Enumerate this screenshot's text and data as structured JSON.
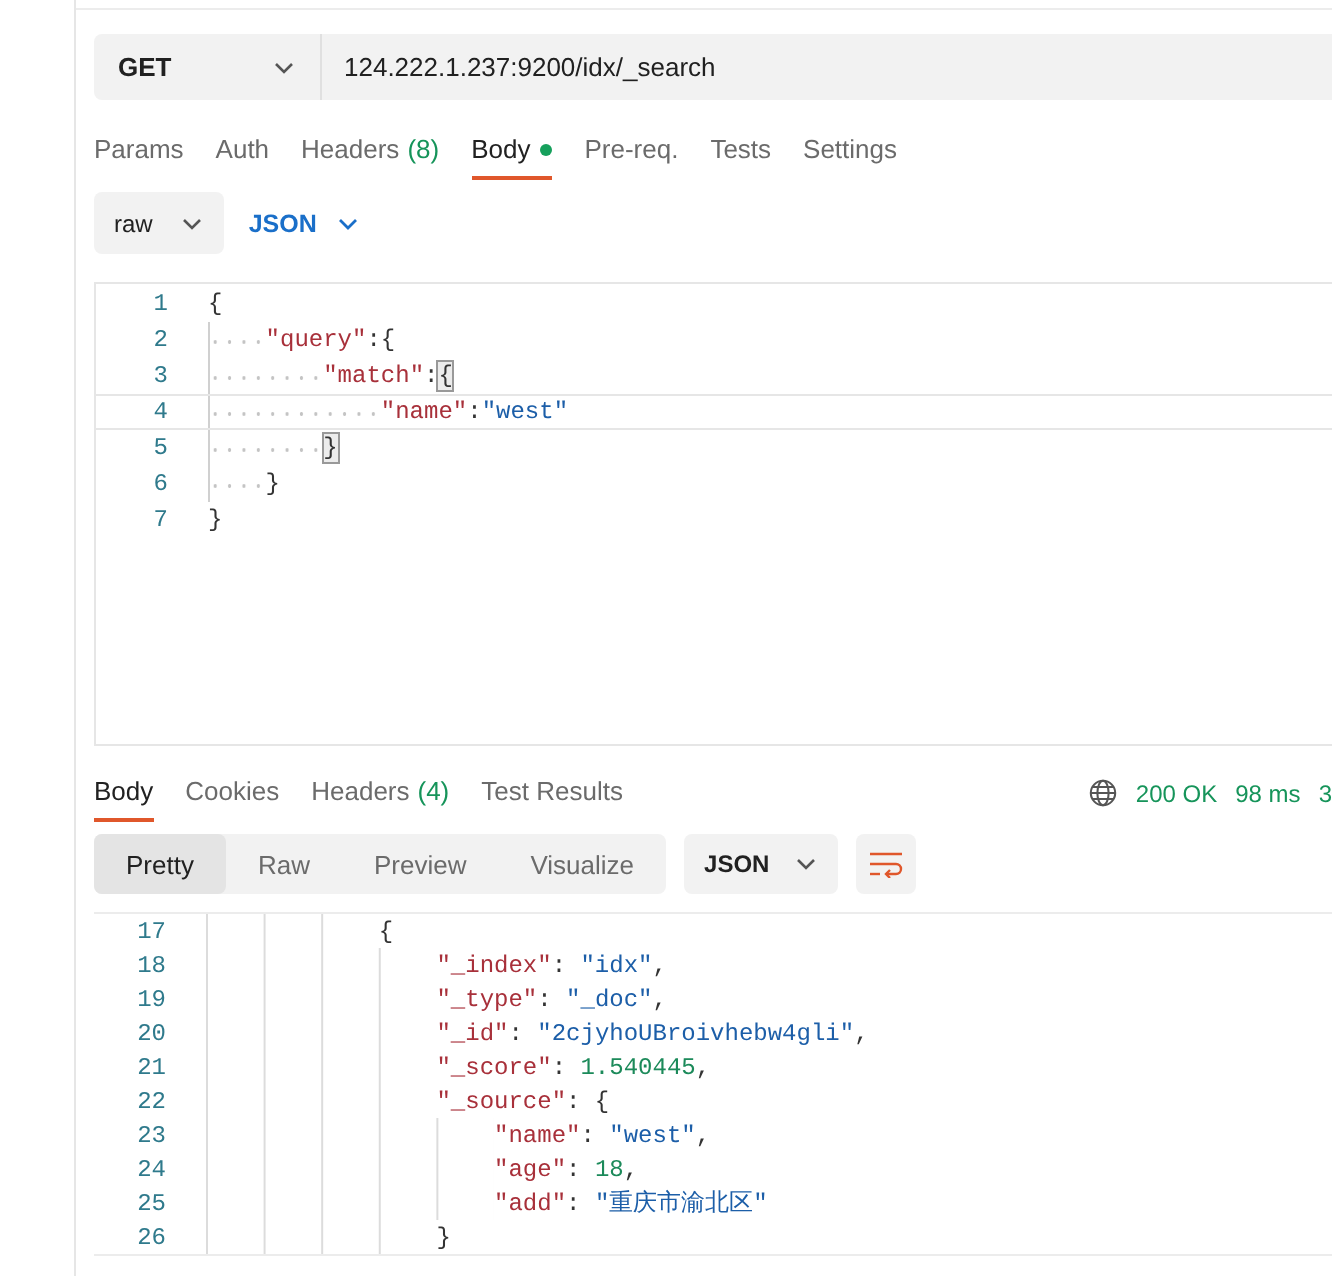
{
  "request": {
    "method": "GET",
    "url": "124.222.1.237:9200/idx/_search"
  },
  "request_tabs": [
    {
      "label": "Params",
      "selected": false
    },
    {
      "label": "Auth",
      "selected": false
    },
    {
      "label": "Headers",
      "count": "(8)",
      "selected": false
    },
    {
      "label": "Body",
      "dot": true,
      "selected": true
    },
    {
      "label": "Pre-req.",
      "selected": false
    },
    {
      "label": "Tests",
      "selected": false
    },
    {
      "label": "Settings",
      "selected": false
    }
  ],
  "body_mode": "raw",
  "body_language": "JSON",
  "request_body": [
    {
      "number": "1",
      "active": false,
      "tokens": [
        {
          "kind": "punct",
          "text": "{"
        }
      ],
      "children": [
        {
          "number": "2",
          "active": false,
          "tokens": [
            {
              "kind": "key",
              "text": "\"query\""
            },
            {
              "kind": "punct",
              "text": ":{"
            }
          ],
          "children": [
            {
              "number": "3",
              "active": false,
              "tokens": [
                {
                  "kind": "key",
                  "text": "\"match\""
                },
                {
                  "kind": "punct",
                  "text": ":"
                },
                {
                  "kind": "punct",
                  "text": "{",
                  "matched": true
                }
              ],
              "children": [
                {
                  "number": "4",
                  "active": true,
                  "tokens": [
                    {
                      "kind": "key",
                      "text": "\"name\""
                    },
                    {
                      "kind": "punct",
                      "text": ":"
                    },
                    {
                      "kind": "string",
                      "text": "\"west\""
                    }
                  ]
                }
              ]
            },
            {
              "number": "5",
              "active": false,
              "tokens": [
                {
                  "kind": "punct",
                  "text": "}",
                  "matched": true
                }
              ]
            }
          ]
        },
        {
          "number": "6",
          "active": false,
          "tokens": [
            {
              "kind": "punct",
              "text": "}"
            }
          ]
        }
      ]
    },
    {
      "number": "7",
      "active": false,
      "tokens": [
        {
          "kind": "punct",
          "text": "}"
        }
      ]
    }
  ],
  "response_tabs": [
    {
      "label": "Body",
      "selected": true
    },
    {
      "label": "Cookies",
      "selected": false
    },
    {
      "label": "Headers",
      "count": "(4)",
      "selected": false
    },
    {
      "label": "Test Results",
      "selected": false
    }
  ],
  "response_status": {
    "status": "200 OK",
    "time": "98 ms",
    "size": "3"
  },
  "view_modes": [
    {
      "label": "Pretty",
      "selected": true
    },
    {
      "label": "Raw",
      "selected": false
    },
    {
      "label": "Preview",
      "selected": false
    },
    {
      "label": "Visualize",
      "selected": false
    }
  ],
  "response_format": "JSON",
  "response_body": [
    {
      "number": "17",
      "tokens": [
        {
          "kind": "punct",
          "text": "{"
        }
      ],
      "children": [
        {
          "number": "18",
          "tokens": [
            {
              "kind": "key",
              "text": "\"_index\""
            },
            {
              "kind": "punct",
              "text": ": "
            },
            {
              "kind": "string",
              "text": "\"idx\""
            },
            {
              "kind": "punct",
              "text": ","
            }
          ]
        },
        {
          "number": "19",
          "tokens": [
            {
              "kind": "key",
              "text": "\"_type\""
            },
            {
              "kind": "punct",
              "text": ": "
            },
            {
              "kind": "string",
              "text": "\"_doc\""
            },
            {
              "kind": "punct",
              "text": ","
            }
          ]
        },
        {
          "number": "20",
          "tokens": [
            {
              "kind": "key",
              "text": "\"_id\""
            },
            {
              "kind": "punct",
              "text": ": "
            },
            {
              "kind": "string",
              "text": "\"2cjyhoUBroivhebw4gli\""
            },
            {
              "kind": "punct",
              "text": ","
            }
          ]
        },
        {
          "number": "21",
          "tokens": [
            {
              "kind": "key",
              "text": "\"_score\""
            },
            {
              "kind": "punct",
              "text": ": "
            },
            {
              "kind": "number",
              "text": "1.540445"
            },
            {
              "kind": "punct",
              "text": ","
            }
          ]
        },
        {
          "number": "22",
          "tokens": [
            {
              "kind": "key",
              "text": "\"_source\""
            },
            {
              "kind": "punct",
              "text": ": {"
            }
          ],
          "children": [
            {
              "number": "23",
              "tokens": [
                {
                  "kind": "key",
                  "text": "\"name\""
                },
                {
                  "kind": "punct",
                  "text": ": "
                },
                {
                  "kind": "string",
                  "text": "\"west\""
                },
                {
                  "kind": "punct",
                  "text": ","
                }
              ]
            },
            {
              "number": "24",
              "tokens": [
                {
                  "kind": "key",
                  "text": "\"age\""
                },
                {
                  "kind": "punct",
                  "text": ": "
                },
                {
                  "kind": "number",
                  "text": "18"
                },
                {
                  "kind": "punct",
                  "text": ","
                }
              ]
            },
            {
              "number": "25",
              "tokens": [
                {
                  "kind": "key",
                  "text": "\"add\""
                },
                {
                  "kind": "punct",
                  "text": ": "
                },
                {
                  "kind": "string",
                  "text": "\"重庆市渝北区\""
                }
              ]
            }
          ]
        },
        {
          "number": "26",
          "tokens": [
            {
              "kind": "punct",
              "text": "}"
            }
          ]
        }
      ]
    }
  ]
}
